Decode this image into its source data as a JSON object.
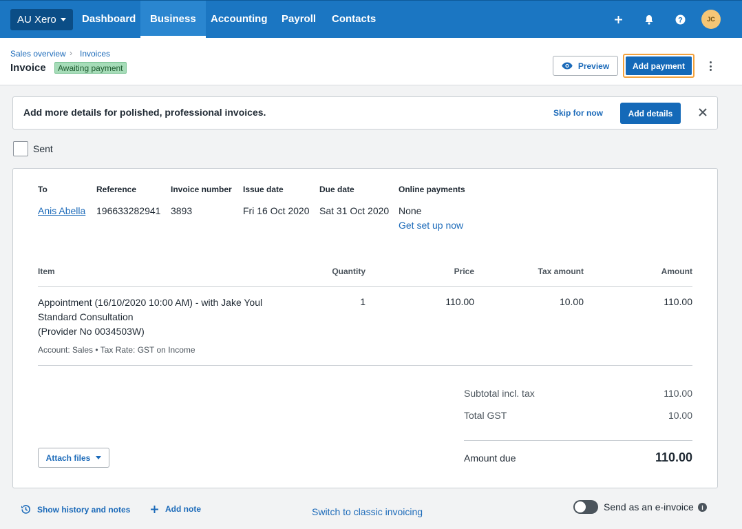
{
  "nav": {
    "org": "AU Xero",
    "items": [
      "Dashboard",
      "Business",
      "Accounting",
      "Payroll",
      "Contacts"
    ],
    "active": "Business",
    "avatar_initials": "JC",
    "icons": [
      "plus-icon",
      "bell-icon",
      "help-icon"
    ]
  },
  "header": {
    "breadcrumb": [
      "Sales overview",
      "Invoices"
    ],
    "title": "Invoice",
    "status": "Awaiting payment",
    "preview_label": "Preview",
    "add_payment_label": "Add payment"
  },
  "banner": {
    "text": "Add more details for polished, professional invoices.",
    "skip": "Skip for now",
    "add_details": "Add details"
  },
  "sent": {
    "label": "Sent",
    "checked": false
  },
  "invoice": {
    "to_label": "To",
    "to": "Anis Abella",
    "reference_label": "Reference",
    "reference": "196633282941",
    "number_label": "Invoice number",
    "number": "3893",
    "issue_label": "Issue date",
    "issue_date": "Fri 16 Oct 2020",
    "due_label": "Due date",
    "due_date": "Sat 31 Oct 2020",
    "online_label": "Online payments",
    "online": "None",
    "setup_link": "Get set up now"
  },
  "table": {
    "columns": [
      "Item",
      "Quantity",
      "Price",
      "Tax amount",
      "Amount"
    ],
    "rows": [
      {
        "line1": "Appointment (16/10/2020 10:00 AM) - with Jake Youl",
        "line2": "Standard Consultation",
        "line3": "(Provider No 0034503W)",
        "sub": "Account: Sales • Tax Rate: GST on Income",
        "quantity": "1",
        "price": "110.00",
        "tax": "10.00",
        "amount": "110.00"
      }
    ]
  },
  "totals": {
    "subtotal_label": "Subtotal incl. tax",
    "subtotal": "110.00",
    "gst_label": "Total GST",
    "gst": "10.00",
    "due_label": "Amount due",
    "due": "110.00"
  },
  "attach_label": "Attach files",
  "footer": {
    "history": "Show history and notes",
    "add_note": "Add note",
    "classic": "Switch to classic invoicing",
    "einvoice": "Send as an e-invoice"
  },
  "colors": {
    "nav": "#1b76c2",
    "primary_button": "#1469b8",
    "focus_ring": "#f4a23c",
    "status_badge": "#a6dcb8"
  }
}
